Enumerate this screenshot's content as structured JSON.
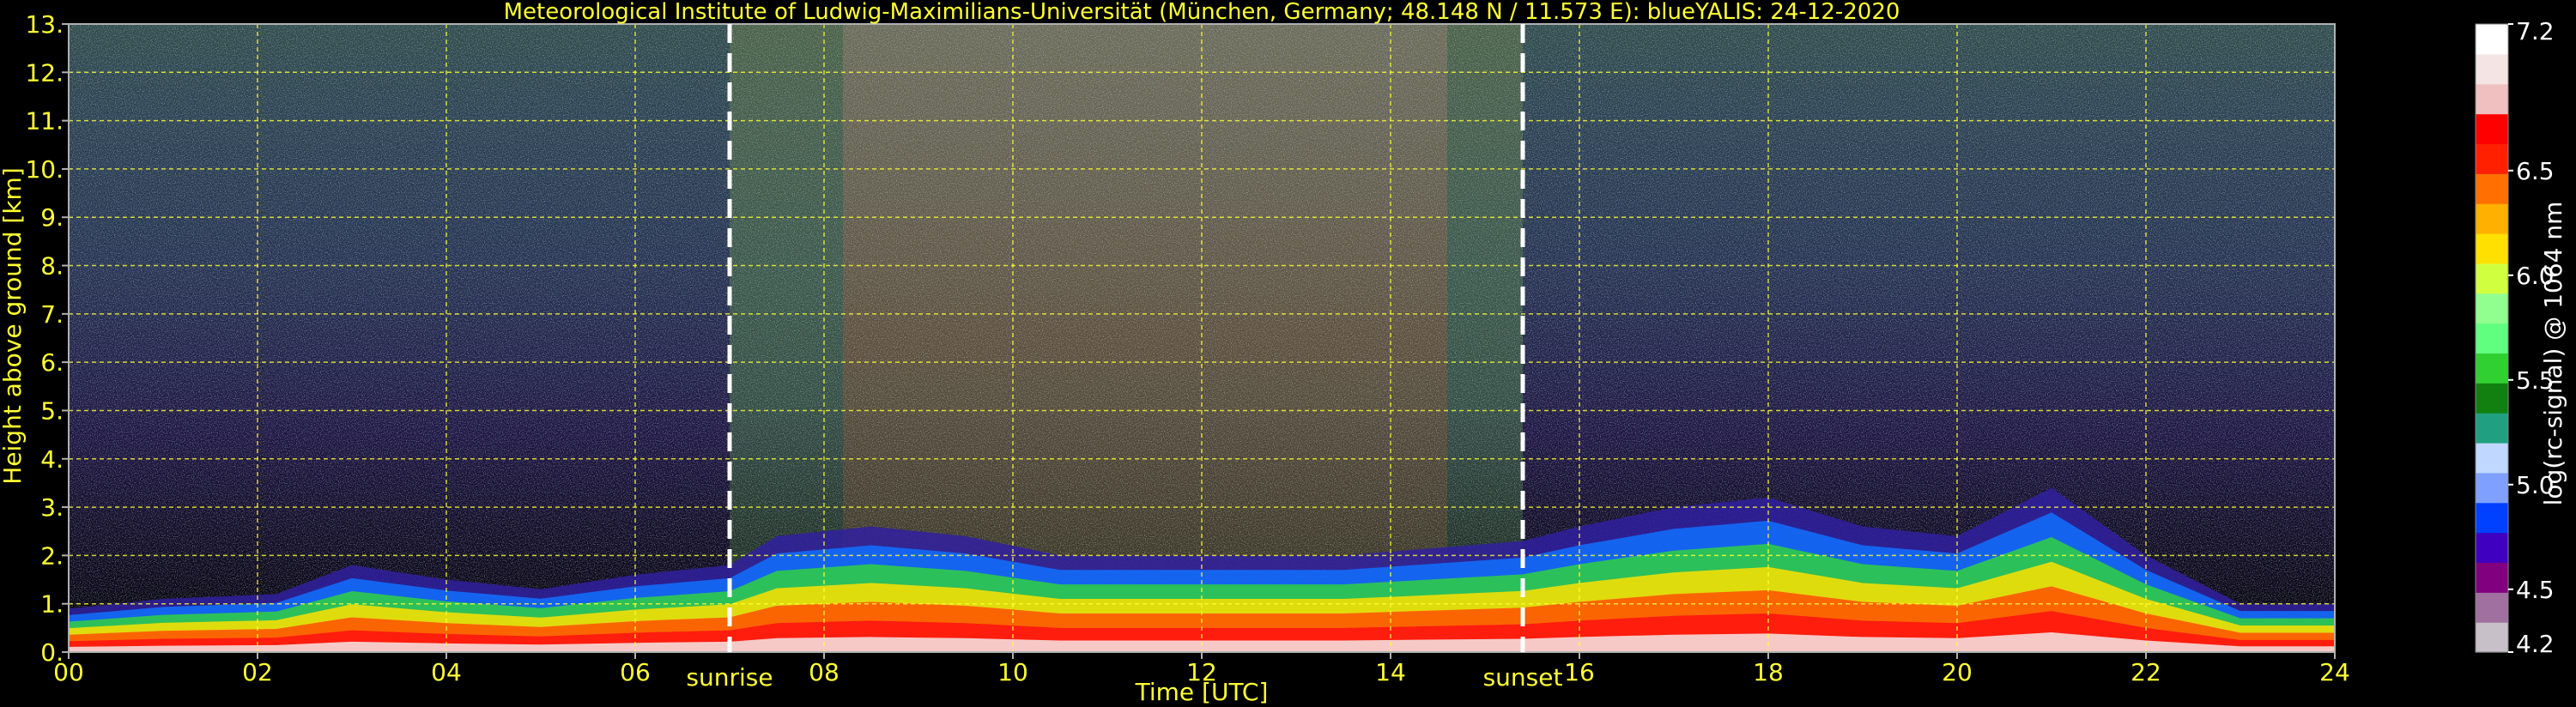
{
  "chart_data": {
    "type": "heatmap",
    "title": "Meteorological Institute of Ludwig-Maximilians-Universität (München, Germany; 48.148 N / 11.573 E):     blueYALIS: 24-12-2020",
    "xlabel": "Time [UTC]",
    "ylabel": "Height above ground [km]",
    "colorbar_label": "log(rc-signal) @ 1064 nm",
    "xlim": [
      0,
      24
    ],
    "ylim": [
      0,
      13
    ],
    "x_ticks": [
      0,
      2,
      4,
      6,
      8,
      10,
      12,
      14,
      16,
      18,
      20,
      22,
      24
    ],
    "x_tick_labels": [
      "00",
      "02",
      "04",
      "06",
      "08",
      "10",
      "12",
      "14",
      "16",
      "18",
      "20",
      "22",
      "24"
    ],
    "y_ticks": [
      0,
      1,
      2,
      3,
      4,
      5,
      6,
      7,
      8,
      9,
      10,
      11,
      12,
      13
    ],
    "y_tick_labels": [
      "0.",
      "1.",
      "2.",
      "3.",
      "4.",
      "5.",
      "6.",
      "7.",
      "8.",
      "9.",
      "10.",
      "11.",
      "12.",
      "13."
    ],
    "grid": true,
    "colorbar": {
      "range": [
        4.2,
        7.2
      ],
      "tick_values": [
        4.2,
        4.5,
        5.0,
        5.5,
        6.0,
        6.5,
        7.2
      ],
      "tick_labels": [
        "4.2",
        "4.5",
        "5.0",
        "5.5",
        "6.0",
        "6.5",
        "7.2"
      ],
      "colors": [
        "#c8c0c8",
        "#a070a0",
        "#800080",
        "#4000c0",
        "#0040ff",
        "#80a0ff",
        "#c0d8ff",
        "#20a080",
        "#108010",
        "#30d030",
        "#60ff80",
        "#90ff90",
        "#d0ff40",
        "#ffe000",
        "#ffb000",
        "#ff7000",
        "#ff2000",
        "#ff0000",
        "#f0c0c0",
        "#f4e4e4",
        "#ffffff"
      ]
    },
    "markers": [
      {
        "label": "sunrise",
        "x": 7.0
      },
      {
        "label": "sunset",
        "x": 15.4
      }
    ],
    "colors": {
      "text": "#ffff33",
      "grid": "#ffff33",
      "frame": "#b0b0b0",
      "colorbar_text": "#ffffff",
      "marker_line": "#ffffff"
    }
  }
}
